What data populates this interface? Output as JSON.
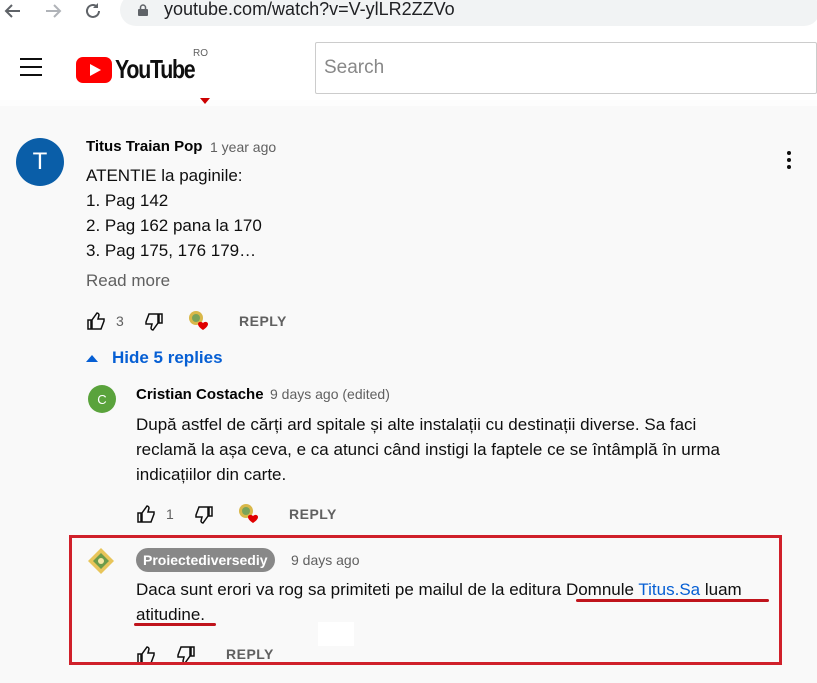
{
  "browser": {
    "url": "youtube.com/watch?v=V-ylLR2ZZVo"
  },
  "header": {
    "logo_text": "YouTube",
    "region": "RO",
    "search_placeholder": "Search"
  },
  "comment": {
    "avatar_letter": "T",
    "avatar_color": "#0a5ea8",
    "author": "Titus Traian Pop",
    "time": "1 year ago",
    "lines": [
      "ATENTIE la paginile:",
      "1. Pag 142",
      "2. Pag 162 pana la 170",
      "3. Pag 175, 176 179…"
    ],
    "read_more": "Read more",
    "likes": "3",
    "reply_label": "REPLY"
  },
  "replies_toggle": "Hide 5 replies",
  "replies": [
    {
      "avatar_letter": "C",
      "avatar_color": "#5aa33c",
      "author": "Cristian Costache",
      "time": "9 days ago (edited)",
      "lines": [
        "După astfel de cărți ard spitale și alte instalații cu destinații diverse. Sa faci",
        "reclamă la așa ceva, e ca atunci când instigi la faptele ce se întâmplă în urma",
        "indicațiilor din carte."
      ],
      "likes": "1",
      "reply_label": "REPLY"
    },
    {
      "author": "Proiectediversediy",
      "time": "9 days ago",
      "line1_text": "Daca sunt erori va rog sa primiteti pe mailul de la editura ",
      "line1_plain2": "Domnule ",
      "line1_link": "Titus.Sa",
      "line1_tail": " luam",
      "line2": "atitudine.",
      "reply_label": "REPLY"
    }
  ],
  "colors": {
    "link": "#065fd4",
    "highlight_frame": "#d0202a",
    "heart": "#e00000"
  }
}
